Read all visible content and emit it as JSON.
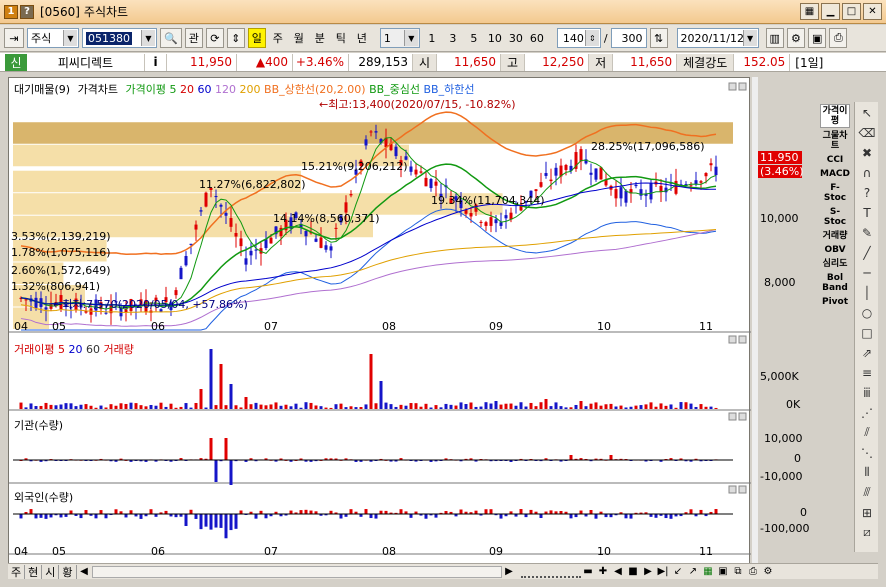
{
  "window": {
    "screen_code": "[0560]",
    "title": "주식차트",
    "icon_num": "1",
    "help": "?"
  },
  "toolbar": {
    "market": "주식",
    "code": "051380",
    "gwan": "관",
    "periods": [
      "일",
      "주",
      "월",
      "분",
      "틱",
      "년"
    ],
    "active_period": "일",
    "interval_value": "1",
    "intervals": [
      "1",
      "3",
      "5",
      "10",
      "30",
      "60"
    ],
    "count": "140",
    "slash": "/",
    "max_count": "300",
    "date": "2020/11/12"
  },
  "quote": {
    "tag": "신",
    "name": "피씨디렉트",
    "info": "i",
    "price": "11,950",
    "change": "▲400",
    "change_pct": "+3.46%",
    "volume": "289,153",
    "open_label": "시",
    "open": "11,650",
    "high_label": "고",
    "high": "12,250",
    "low_label": "저",
    "low": "11,650",
    "strength_label": "체결강도",
    "strength": "152.05",
    "period_label": "[1일]"
  },
  "legend_main": [
    "대기매물(9)",
    "가격차트",
    "가격이평 5",
    "20",
    "60",
    "120",
    "200",
    "BB_상한선(20,2.00)",
    "BB_중심선",
    "BB_하한선"
  ],
  "annotations": {
    "high": "←최고:13,400(2020/07/15, -10.82%)",
    "low": "←최저:7,570(2020/05/04, +57.86%)",
    "price_tag": "11,950",
    "price_tag_pct": "(3.46%)",
    "vp1": "28.25%(17,096,586)",
    "vp2": "15.21%(9,206,212)",
    "vp3": "11.27%(6,822,802)",
    "vp4": "19.34%(11,704,344)",
    "vp5": "14.14%(8,560,371)",
    "vp6": "3.53%(2,139,219)",
    "vp7": "1.78%(1,075,116)",
    "vp8": "2.60%(1,572,649)",
    "vp9": "1.32%(806,941)"
  },
  "legend_vol": [
    "거래이평 5",
    "20",
    "60",
    "거래량"
  ],
  "legend_inst": "기관(수량)",
  "legend_foreign": "외국인(수량)",
  "axes": {
    "price_ticks": [
      "10,000",
      "8,000"
    ],
    "vol_ticks": [
      "5,000K",
      "0K"
    ],
    "inst_ticks": [
      "10,000",
      "0",
      "-10,000"
    ],
    "foreign_ticks": [
      "0",
      "-100,000"
    ],
    "months": [
      "04",
      "05",
      "06",
      "07",
      "08",
      "09",
      "10",
      "11"
    ]
  },
  "right_indicators": [
    "가격이평",
    "그물차트",
    "CCI",
    "MACD",
    "F-Stoc",
    "S-Stoc",
    "거래량",
    "OBV",
    "심리도",
    "Bol Band",
    "Pivot"
  ],
  "bottom_tabs": [
    "주",
    "현",
    "시",
    "황"
  ],
  "colors": {
    "up": "#e00000",
    "down": "#1515c8",
    "ma5": "#119911",
    "ma20": "#d40000",
    "ma60": "#0000cc",
    "ma120": "#b070d0",
    "ma200": "#e0a000",
    "bb_upper": "#f07020",
    "bb_mid": "#119911",
    "bb_lower": "#2060e0",
    "vol_band": "#f5dfa8",
    "vol_band_max": "#d9b56c"
  }
}
